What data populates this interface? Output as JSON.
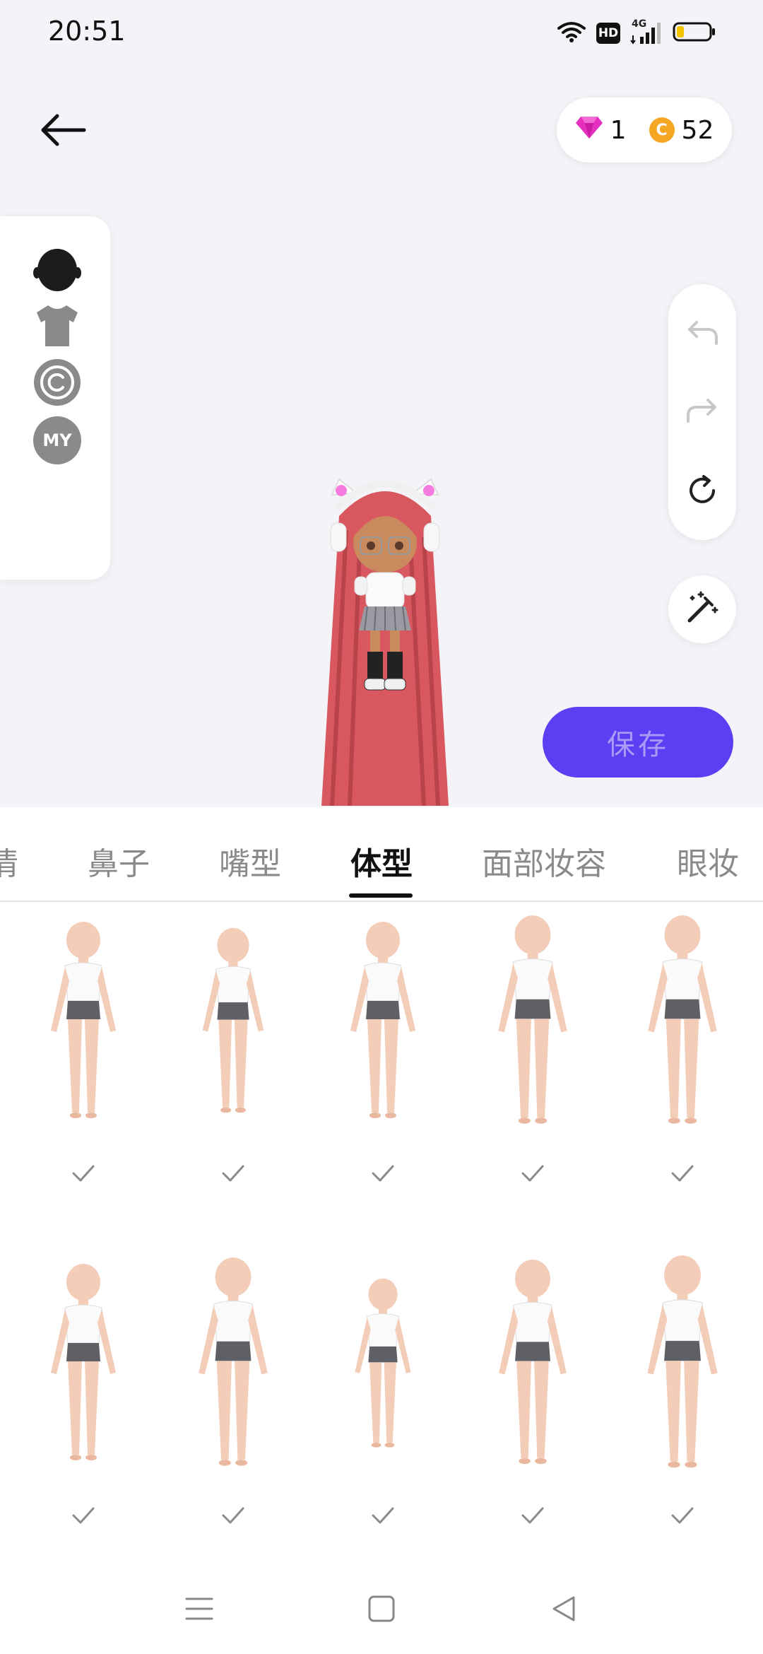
{
  "status_bar": {
    "time": "20:51",
    "hd_label": "HD",
    "network_label": "4G"
  },
  "wallet": {
    "gems": "1",
    "coin_symbol": "C",
    "coins": "52",
    "gem_color": "#e52fbf",
    "coin_color": "#f5a623"
  },
  "rail": {
    "items": [
      {
        "icon": "head-silhouette-icon"
      },
      {
        "icon": "tshirt-icon"
      },
      {
        "icon": "copyright-icon"
      },
      {
        "icon": "my-icon",
        "label": "MY"
      }
    ]
  },
  "toolbar": {
    "save_label": "保存",
    "accent": "#5b3ff2"
  },
  "tabs": [
    {
      "label": "情",
      "active": false
    },
    {
      "label": "鼻子",
      "active": false
    },
    {
      "label": "嘴型",
      "active": false
    },
    {
      "label": "体型",
      "active": true
    },
    {
      "label": "面部妆容",
      "active": false
    },
    {
      "label": "眼妆",
      "active": false
    }
  ],
  "body_types": [
    {
      "selected": false
    },
    {
      "selected": false
    },
    {
      "selected": false
    },
    {
      "selected": false
    },
    {
      "selected": false
    },
    {
      "selected": false
    },
    {
      "selected": false
    },
    {
      "selected": false
    },
    {
      "selected": false
    },
    {
      "selected": false
    }
  ],
  "nav": {
    "items": [
      "menu-icon",
      "home-icon",
      "back-icon"
    ]
  }
}
